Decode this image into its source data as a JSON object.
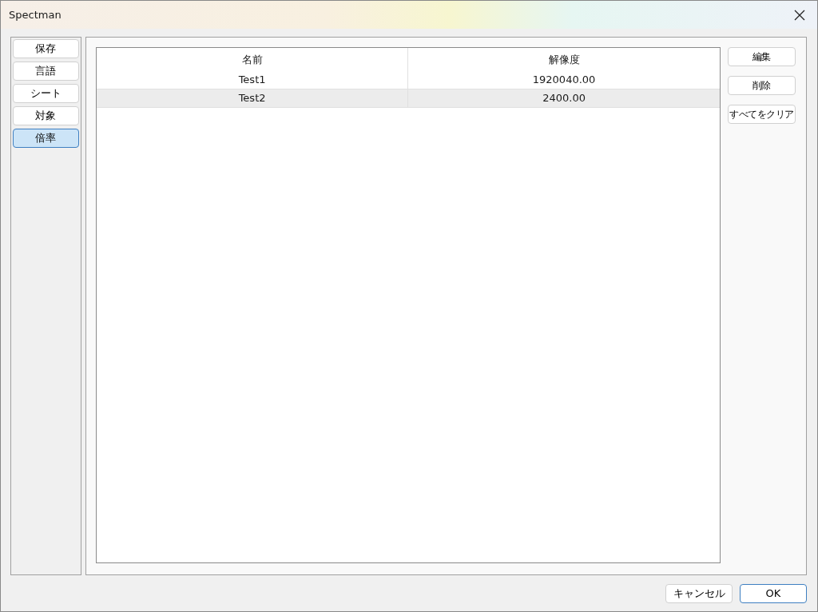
{
  "window": {
    "title": "Spectman"
  },
  "sidebar": {
    "items": [
      {
        "label": "保存",
        "selected": false
      },
      {
        "label": "言語",
        "selected": false
      },
      {
        "label": "シート",
        "selected": false
      },
      {
        "label": "対象",
        "selected": false
      },
      {
        "label": "倍率",
        "selected": true
      }
    ]
  },
  "table": {
    "columns": [
      "名前",
      "解像度"
    ],
    "rows": [
      {
        "cells": [
          "Test1",
          "1920040.00"
        ],
        "selected": false
      },
      {
        "cells": [
          "Test2",
          "2400.00"
        ],
        "selected": true
      }
    ]
  },
  "side_buttons": [
    "編集",
    "削除",
    "すべてをクリア"
  ],
  "footer_buttons": [
    {
      "label": "キャンセル",
      "kind": "default"
    },
    {
      "label": "OK",
      "kind": "primary"
    }
  ]
}
